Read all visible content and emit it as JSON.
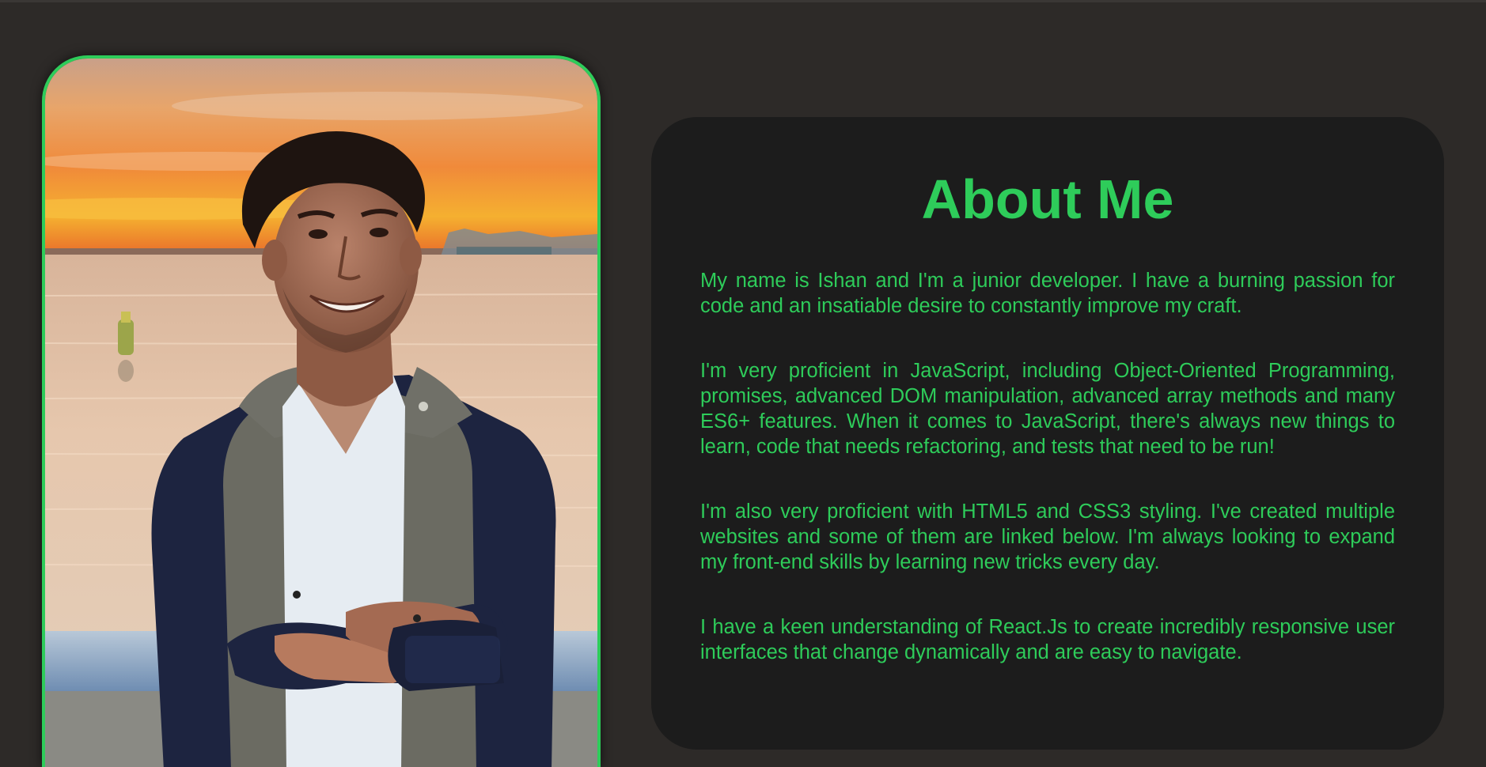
{
  "photo": {
    "alt": "Portrait of Ishan standing by the water at sunset"
  },
  "about": {
    "title": "About Me",
    "paragraphs": [
      "My name is Ishan and I'm a junior developer. I have a burning passion for code and an insatiable desire to constantly improve my craft.",
      "I'm very proficient in JavaScript, including Object-Oriented Programming, promises, advanced DOM manipulation, advanced array methods and many ES6+ features. When it comes to JavaScript, there's always new things to learn, code that needs refactoring, and tests that need to be run!",
      "I'm also very proficient with HTML5 and CSS3 styling. I've created multiple websites and some of them are linked below. I'm always looking to expand my front-end skills by learning new tricks every day.",
      "I have a keen understanding of React.Js to create incredibly responsive user interfaces that change dynamically and are easy to navigate."
    ]
  },
  "colors": {
    "background": "#2d2a28",
    "card": "#1c1c1c",
    "accent": "#2ecc5a"
  }
}
